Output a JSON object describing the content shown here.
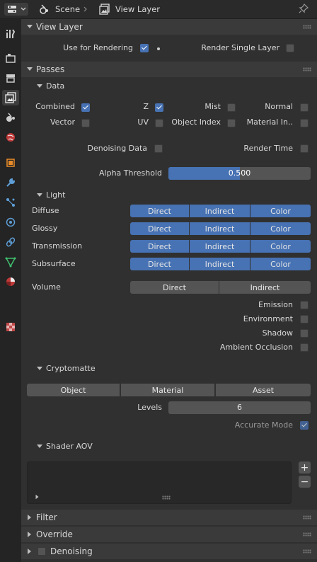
{
  "header": {
    "scene_label": "Scene",
    "view_layer_label": "View Layer"
  },
  "sidebar": {
    "tabs": [
      "tool-icon",
      "render-icon",
      "output-icon",
      "view-layer-icon",
      "scene-icon",
      "world-icon",
      "object-icon",
      "modifier-icon",
      "particles-icon",
      "physics-icon",
      "constraints-icon",
      "data-icon",
      "material-icon",
      "texture-icon"
    ]
  },
  "view_layer": {
    "title": "View Layer",
    "use_for_rendering": "Use for Rendering",
    "render_single_layer": "Render Single Layer"
  },
  "passes": {
    "title": "Passes",
    "data": {
      "title": "Data",
      "combined": "Combined",
      "z": "Z",
      "mist": "Mist",
      "normal": "Normal",
      "vector": "Vector",
      "uv": "UV",
      "object_index": "Object Index",
      "material_index": "Material In..",
      "denoising_data": "Denoising Data",
      "render_time": "Render Time",
      "alpha_threshold_label": "Alpha Threshold",
      "alpha_threshold_value": "0.500",
      "alpha_threshold_fraction": 0.5
    },
    "light": {
      "title": "Light",
      "rows": [
        {
          "label": "Diffuse",
          "direct": "Direct",
          "indirect": "Indirect",
          "color": "Color"
        },
        {
          "label": "Glossy",
          "direct": "Direct",
          "indirect": "Indirect",
          "color": "Color"
        },
        {
          "label": "Transmission",
          "direct": "Direct",
          "indirect": "Indirect",
          "color": "Color"
        },
        {
          "label": "Subsurface",
          "direct": "Direct",
          "indirect": "Indirect",
          "color": "Color"
        }
      ],
      "volume": {
        "label": "Volume",
        "direct": "Direct",
        "indirect": "Indirect"
      },
      "emission": "Emission",
      "environment": "Environment",
      "shadow": "Shadow",
      "ambient_occlusion": "Ambient Occlusion"
    },
    "cryptomatte": {
      "title": "Cryptomatte",
      "object": "Object",
      "material": "Material",
      "asset": "Asset",
      "levels_label": "Levels",
      "levels_value": "6",
      "accurate_mode": "Accurate Mode"
    },
    "shader_aov": {
      "title": "Shader AOV"
    }
  },
  "filter": {
    "title": "Filter"
  },
  "override": {
    "title": "Override"
  },
  "denoising": {
    "title": "Denoising"
  },
  "colors": {
    "accent": "#4772b3",
    "panel": "#303030",
    "header": "#3a3a3a",
    "button": "#545454"
  }
}
